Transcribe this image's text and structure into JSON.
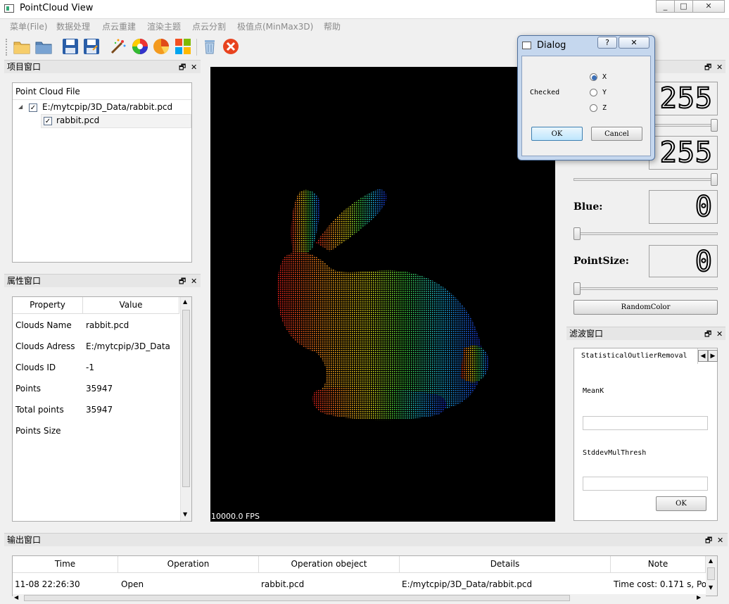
{
  "window": {
    "title": "PointCloud View",
    "controls": [
      "_",
      "□",
      "✕"
    ]
  },
  "menu": [
    "菜单(File)",
    "数据处理",
    "点云重建",
    "渲染主题",
    "点云分割",
    "极值点(MinMax3D)",
    "帮助"
  ],
  "toolbar": {
    "icons": [
      "open-folder-icon",
      "open-file-icon",
      "save-icon",
      "save-as-icon",
      "magic-wand-icon",
      "color-wheel-icon",
      "pie-icon",
      "theme-icon",
      "delete-icon",
      "close-red-icon"
    ]
  },
  "project_dock": {
    "title": "项目窗口",
    "header": "Point Cloud File",
    "tree": [
      {
        "label": "E:/mytcpip/3D_Data/rabbit.pcd",
        "checked": true
      },
      {
        "label": "rabbit.pcd",
        "checked": true
      }
    ]
  },
  "property_dock": {
    "title": "属性窗口",
    "headers": [
      "Property",
      "Value"
    ],
    "rows": [
      {
        "property": "Clouds Name",
        "value": "rabbit.pcd"
      },
      {
        "property": "Clouds Adress",
        "value": "E:/mytcpip/3D_Data"
      },
      {
        "property": "Clouds ID",
        "value": "-1"
      },
      {
        "property": "Points",
        "value": "35947"
      },
      {
        "property": "Total points",
        "value": "35947"
      },
      {
        "property": "Points Size",
        "value": ""
      }
    ]
  },
  "viewer": {
    "fps": "10000.0 FPS",
    "background": "#000000"
  },
  "color_dock": {
    "red_value": "255",
    "green_value": "255",
    "blue_label": "Blue:",
    "blue_value": "0",
    "pointsize_label": "PointSize:",
    "pointsize_value": "0",
    "random_button": "RandomColor",
    "slider_levels": {
      "red": 1.0,
      "green": 1.0,
      "blue": 0.0,
      "pointsize": 0.0
    }
  },
  "filter_dock": {
    "title": "滤波窗口",
    "tab": "StatisticalOutlierRemoval",
    "meank_label": "MeanK",
    "meank_value": "",
    "stddev_label": "StddevMulThresh",
    "stddev_value": "",
    "ok_button": "OK"
  },
  "dialog": {
    "title": "Dialog",
    "help": "?",
    "close": "✕",
    "checked_label": "Checked",
    "options": [
      {
        "label": "X",
        "selected": true
      },
      {
        "label": "Y",
        "selected": false
      },
      {
        "label": "Z",
        "selected": false
      }
    ],
    "ok": "OK",
    "cancel": "Cancel"
  },
  "output_dock": {
    "title": "输出窗口",
    "headers": [
      "Time",
      "Operation",
      "Operation obeject",
      "Details",
      "Note"
    ],
    "rows": [
      {
        "time": "11-08 22:26:30",
        "operation": "Open",
        "object": "rabbit.pcd",
        "details": "E:/mytcpip/3D_Data/rabbit.pcd",
        "note": "Time cost: 0.171 s, Poin"
      }
    ]
  },
  "colors": {
    "accent": "#3399ff",
    "selection": "#cde8ff",
    "close_red": "#e81123"
  }
}
